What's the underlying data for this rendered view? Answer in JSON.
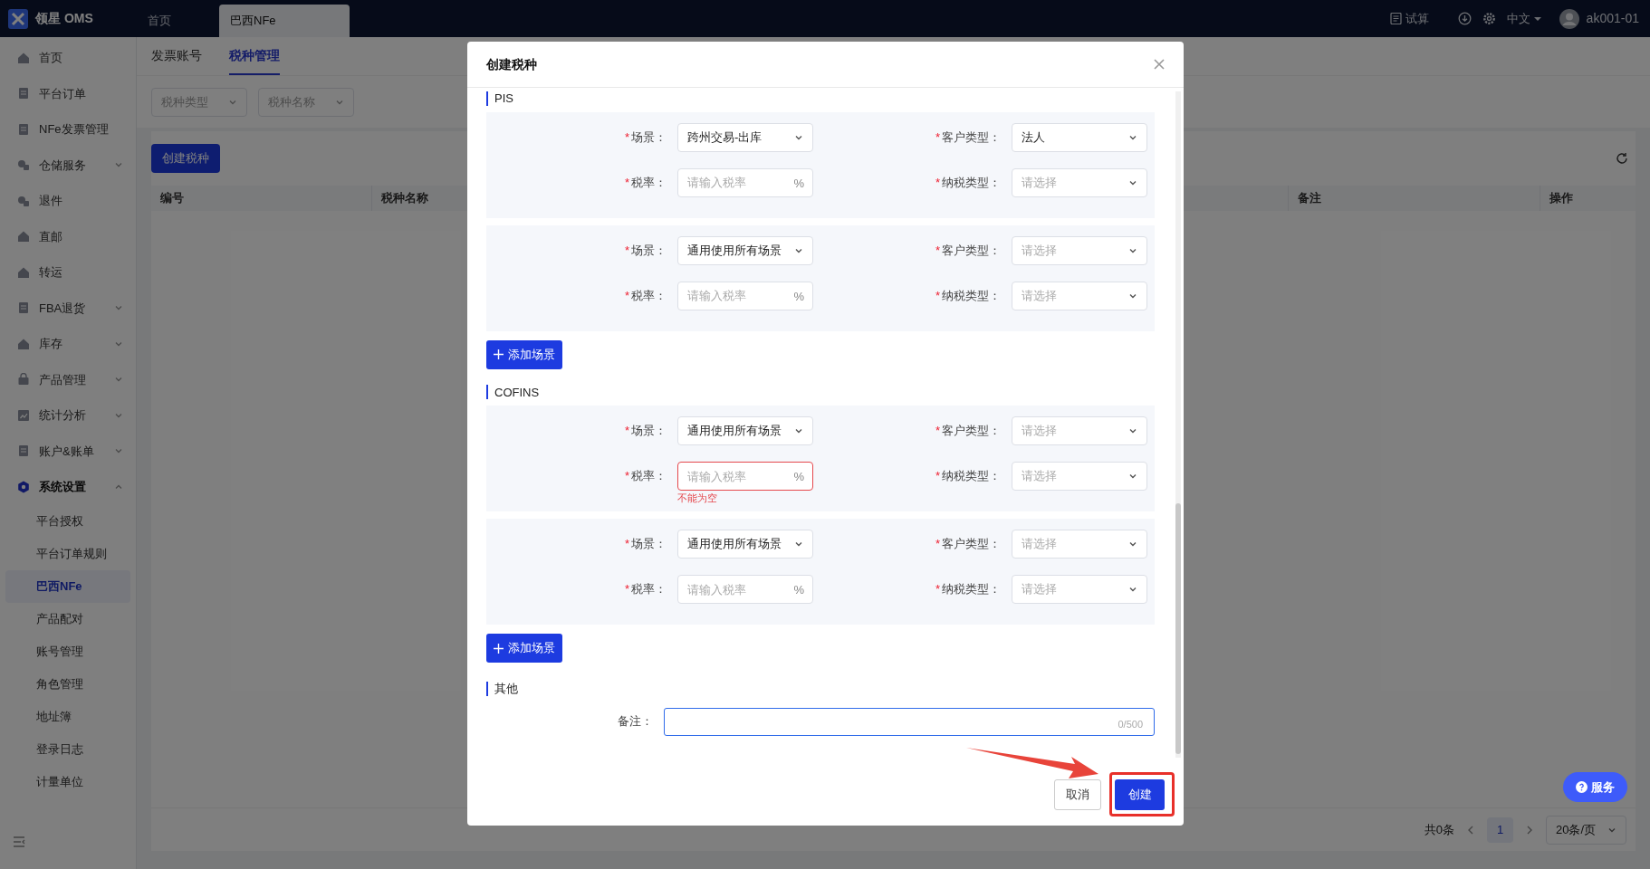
{
  "app": {
    "logo_text": "领星 OMS"
  },
  "top_tabs": [
    {
      "label": "首页",
      "selected": false
    },
    {
      "label": "巴西NFe",
      "selected": true
    }
  ],
  "top_right": {
    "calc": "试算",
    "language": "中文",
    "user": "ak001-01"
  },
  "sidebar": {
    "items": [
      {
        "label": "首页"
      },
      {
        "label": "平台订单"
      },
      {
        "label": "NFe发票管理"
      },
      {
        "label": "仓储服务",
        "expanded": false
      },
      {
        "label": "退件"
      },
      {
        "label": "直邮"
      },
      {
        "label": "转运"
      },
      {
        "label": "FBA退货",
        "expanded": false
      },
      {
        "label": "库存",
        "expanded": false
      },
      {
        "label": "产品管理",
        "expanded": false
      },
      {
        "label": "统计分析",
        "expanded": false
      },
      {
        "label": "账户&账单",
        "expanded": false
      },
      {
        "label": "系统设置",
        "expanded": true,
        "children": [
          {
            "label": "平台授权",
            "selected": false
          },
          {
            "label": "平台订单规则",
            "selected": false
          },
          {
            "label": "巴西NFe",
            "selected": true
          },
          {
            "label": "产品配对",
            "selected": false
          },
          {
            "label": "账号管理",
            "selected": false
          },
          {
            "label": "角色管理",
            "selected": false
          },
          {
            "label": "地址簿",
            "selected": false
          },
          {
            "label": "登录日志",
            "selected": false
          },
          {
            "label": "计量单位",
            "selected": false
          }
        ]
      }
    ]
  },
  "sub_tabs": [
    {
      "label": "发票账号",
      "selected": false
    },
    {
      "label": "税种管理",
      "selected": true
    }
  ],
  "filters": [
    {
      "placeholder": "税种类型"
    },
    {
      "placeholder": "税种名称"
    }
  ],
  "create_button": "创建税种",
  "table": {
    "columns": [
      "编号",
      "税种名称",
      "备注",
      "操作"
    ]
  },
  "pagination": {
    "total": "共0条",
    "pages": [
      {
        "label": "1",
        "selected": true
      }
    ],
    "page_size": "20条/页"
  },
  "service_button": "服务",
  "modal": {
    "title": "创建税种",
    "sections": [
      {
        "title": "PIS",
        "groups": [
          {
            "fields": [
              {
                "kind": "select",
                "mark": "*",
                "label": "场景：",
                "value": "跨州交易-出库"
              },
              {
                "kind": "select",
                "mark": "*",
                "label": "客户类型：",
                "value": "法人"
              },
              {
                "kind": "rate",
                "mark": "*",
                "label": "税率：",
                "placeholder": "请输入税率",
                "unit": "%"
              },
              {
                "kind": "select",
                "mark": "*",
                "label": "纳税类型：",
                "placeholder": "请选择"
              }
            ]
          },
          {
            "fields": [
              {
                "kind": "select",
                "mark": "*",
                "label": "场景：",
                "value": "通用使用所有场景"
              },
              {
                "kind": "select",
                "mark": "*",
                "label": "客户类型：",
                "placeholder": "请选择"
              },
              {
                "kind": "rate",
                "mark": "*",
                "label": "税率：",
                "placeholder": "请输入税率",
                "unit": "%"
              },
              {
                "kind": "select",
                "mark": "*",
                "label": "纳税类型：",
                "placeholder": "请选择"
              }
            ]
          }
        ],
        "add_button": "添加场景"
      },
      {
        "title": "COFINS",
        "groups": [
          {
            "fields": [
              {
                "kind": "select",
                "mark": "*",
                "label": "场景：",
                "value": "通用使用所有场景"
              },
              {
                "kind": "select",
                "mark": "*",
                "label": "客户类型：",
                "placeholder": "请选择"
              },
              {
                "kind": "rate",
                "mark": "*",
                "label": "税率：",
                "placeholder": "请输入税率",
                "unit": "%",
                "error": "不能为空"
              },
              {
                "kind": "select",
                "mark": "*",
                "label": "纳税类型：",
                "placeholder": "请选择"
              }
            ]
          },
          {
            "fields": [
              {
                "kind": "select",
                "mark": "*",
                "label": "场景：",
                "value": "通用使用所有场景"
              },
              {
                "kind": "select",
                "mark": "*",
                "label": "客户类型：",
                "placeholder": "请选择"
              },
              {
                "kind": "rate",
                "mark": "*",
                "label": "税率：",
                "placeholder": "请输入税率",
                "unit": "%"
              },
              {
                "kind": "select",
                "mark": "*",
                "label": "纳税类型：",
                "placeholder": "请选择"
              }
            ]
          }
        ],
        "add_button": "添加场景"
      }
    ],
    "other": {
      "title": "其他",
      "remark": {
        "label": "备注：",
        "counter": "0/500",
        "focused": true
      }
    },
    "buttons": {
      "cancel": "取消",
      "create": "创建"
    }
  }
}
